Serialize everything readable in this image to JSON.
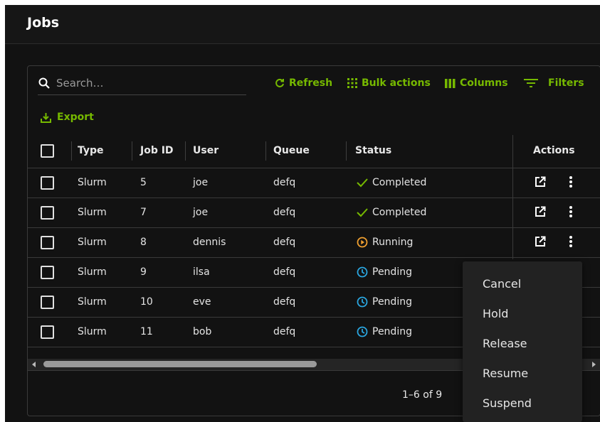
{
  "page": {
    "title": "Jobs"
  },
  "toolbar": {
    "search_placeholder": "Search…",
    "refresh_label": "Refresh",
    "bulk_actions_label": "Bulk actions",
    "columns_label": "Columns",
    "filters_label": "Filters",
    "export_label": "Export"
  },
  "table": {
    "headers": {
      "type": "Type",
      "job_id": "Job ID",
      "user": "User",
      "queue": "Queue",
      "status": "Status",
      "actions": "Actions"
    },
    "rows": [
      {
        "type": "Slurm",
        "job_id": "5",
        "user": "joe",
        "queue": "defq",
        "status": "Completed",
        "status_icon": "check-icon"
      },
      {
        "type": "Slurm",
        "job_id": "7",
        "user": "joe",
        "queue": "defq",
        "status": "Completed",
        "status_icon": "check-icon"
      },
      {
        "type": "Slurm",
        "job_id": "8",
        "user": "dennis",
        "queue": "defq",
        "status": "Running",
        "status_icon": "play-circle-icon"
      },
      {
        "type": "Slurm",
        "job_id": "9",
        "user": "ilsa",
        "queue": "defq",
        "status": "Pending",
        "status_icon": "clock-icon"
      },
      {
        "type": "Slurm",
        "job_id": "10",
        "user": "eve",
        "queue": "defq",
        "status": "Pending",
        "status_icon": "clock-icon"
      },
      {
        "type": "Slurm",
        "job_id": "11",
        "user": "bob",
        "queue": "defq",
        "status": "Pending",
        "status_icon": "clock-icon"
      }
    ]
  },
  "pagination": {
    "range_text": "1–6 of 9"
  },
  "context_menu": {
    "items": [
      "Cancel",
      "Hold",
      "Release",
      "Resume",
      "Suspend"
    ]
  },
  "colors": {
    "accent": "#76b900",
    "running": "#f0a030",
    "pending": "#2aa6e0",
    "completed": "#76b900"
  }
}
